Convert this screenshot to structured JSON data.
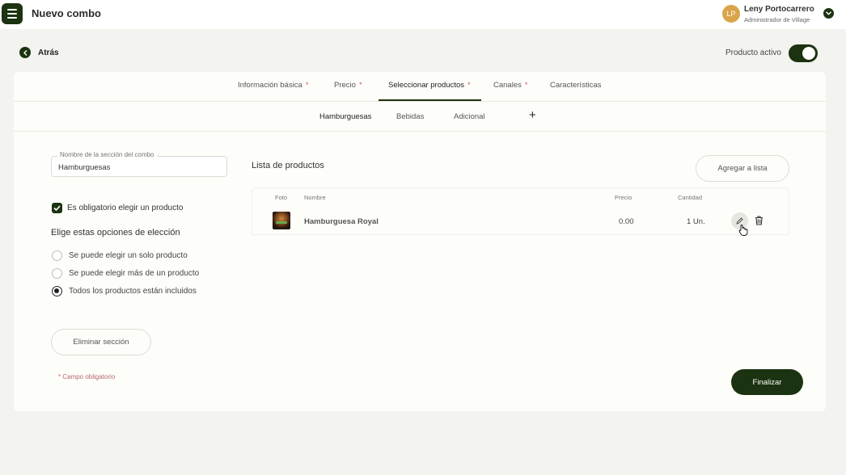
{
  "header": {
    "title": "Nuevo combo",
    "avatar_initials": "LP",
    "user_name": "Leny Portocarrero",
    "user_role": "Administrador de Village"
  },
  "toolbar": {
    "back_label": "Atrás",
    "active_label": "Producto activo",
    "active": true
  },
  "tabs": [
    {
      "label": "Información básica",
      "required": "*"
    },
    {
      "label": "Precio",
      "required": "*"
    },
    {
      "label": "Seleccionar productos",
      "required": "*"
    },
    {
      "label": "Canales",
      "required": "*"
    },
    {
      "label": "Características"
    }
  ],
  "subtabs": [
    "Hamburguesas",
    "Bebidas",
    "Adicional"
  ],
  "subtab_add": "+",
  "section": {
    "name_label": "Nombre de la sección del combo",
    "name_value": "Hamburguesas",
    "required_checkbox": "Es obligatorio elegir un producto",
    "options_title": "Elige estas opciones de elección",
    "options": [
      "Se puede elegir un solo producto",
      "Se puede elegir más de un producto",
      "Todos los productos están incluidos"
    ],
    "selected_option": 2,
    "delete_label": "Eliminar sección",
    "required_note": "* Campo obligatorio"
  },
  "products": {
    "title": "Lista de productos",
    "add_label": "Agregar a lista",
    "columns": [
      "Foto",
      "Nombre",
      "Precio",
      "Cantidad"
    ],
    "rows": [
      {
        "name": "Hamburguesa Royal",
        "price": "0.00",
        "quantity": "1 Un."
      }
    ]
  },
  "finish_label": "Finalizar",
  "colors": {
    "accent": "#1b3310",
    "avatar": "#d9a54b",
    "required": "#d06060"
  }
}
